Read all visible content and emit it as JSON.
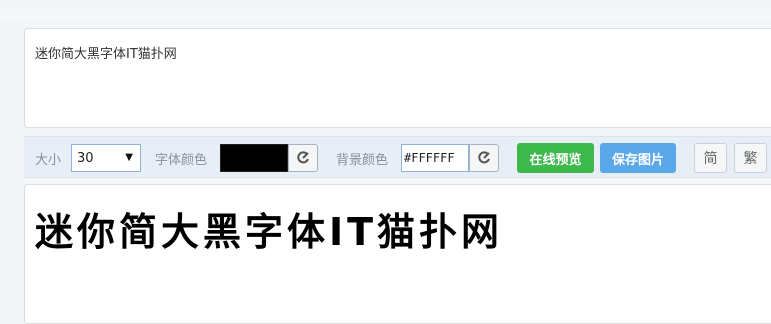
{
  "input": {
    "text": "迷你简大黑字体IT猫扑网"
  },
  "toolbar": {
    "size_label": "大小",
    "size_value": "30",
    "font_color_label": "字体颜色",
    "font_color": "#000000",
    "bg_color_label": "背景颜色",
    "bg_color_value": "#FFFFFF",
    "preview_button": "在线预览",
    "save_button": "保存图片",
    "simplified_button": "简",
    "traditional_button": "繁"
  },
  "preview": {
    "text": "迷你简大黑字体IT猫扑网"
  },
  "icons": {
    "picker": "color-picker-icon",
    "caret": "dropdown-caret-icon"
  }
}
